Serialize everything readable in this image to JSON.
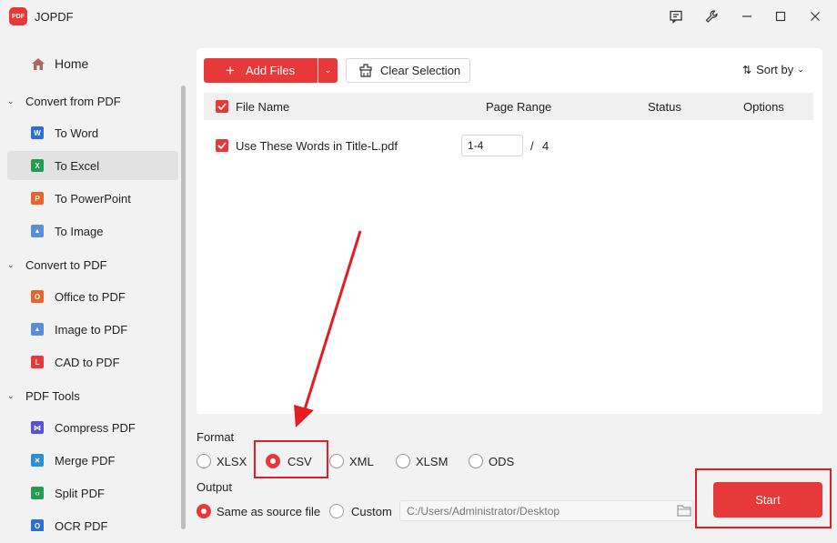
{
  "app": {
    "title": "JOPDF",
    "logo_text": "PDF"
  },
  "titlebar": {
    "icons": [
      "feedback-icon",
      "wrench-icon",
      "minimize-icon",
      "maximize-icon",
      "close-icon"
    ]
  },
  "sidebar": {
    "home": "Home",
    "sections": [
      {
        "label": "Convert from PDF",
        "items": [
          {
            "label": "To Word",
            "icon": "word-icon",
            "color": "#2b6fd6",
            "glyph": "W"
          },
          {
            "label": "To Excel",
            "icon": "excel-icon",
            "color": "#1f9d55",
            "glyph": "X",
            "active": true
          },
          {
            "label": "To PowerPoint",
            "icon": "powerpoint-icon",
            "color": "#e8642c",
            "glyph": "P"
          },
          {
            "label": "To Image",
            "icon": "image-icon",
            "color": "#5a8fd8",
            "glyph": "▲"
          }
        ]
      },
      {
        "label": "Convert to PDF",
        "items": [
          {
            "label": "Office to PDF",
            "icon": "office-icon",
            "color": "#e8642c",
            "glyph": "O"
          },
          {
            "label": "Image to PDF",
            "icon": "image-icon",
            "color": "#5a8fd8",
            "glyph": "▲"
          },
          {
            "label": "CAD to PDF",
            "icon": "cad-icon",
            "color": "#e8393a",
            "glyph": "L"
          }
        ]
      },
      {
        "label": "PDF Tools",
        "items": [
          {
            "label": "Compress PDF",
            "icon": "compress-icon",
            "color": "#5b4fd6",
            "glyph": "⋈"
          },
          {
            "label": "Merge PDF",
            "icon": "merge-icon",
            "color": "#2b8fd6",
            "glyph": "✕"
          },
          {
            "label": "Split PDF",
            "icon": "split-icon",
            "color": "#1f9d55",
            "glyph": "‹›"
          },
          {
            "label": "OCR PDF",
            "icon": "ocr-icon",
            "color": "#2b6fd6",
            "glyph": "O"
          }
        ]
      }
    ]
  },
  "toolbar": {
    "add_files": "Add Files",
    "clear_selection": "Clear Selection",
    "sort_by": "Sort by"
  },
  "table": {
    "headers": {
      "file_name": "File Name",
      "page_range": "Page Range",
      "status": "Status",
      "options": "Options"
    },
    "rows": [
      {
        "file_name": "Use These Words in Title-L.pdf",
        "page_range": "1-4",
        "separator": "/",
        "total_pages": "4",
        "checked": true
      }
    ]
  },
  "format": {
    "label": "Format",
    "options": [
      "XLSX",
      "CSV",
      "XML",
      "XLSM",
      "ODS"
    ],
    "selected": "CSV"
  },
  "output": {
    "label": "Output",
    "options": [
      "Same as source file",
      "Custom"
    ],
    "selected": "Same as source file",
    "path_placeholder": "C:/Users/Administrator/Desktop"
  },
  "start_button": "Start",
  "colors": {
    "accent": "#e8393a",
    "annotation": "#e31d22"
  }
}
